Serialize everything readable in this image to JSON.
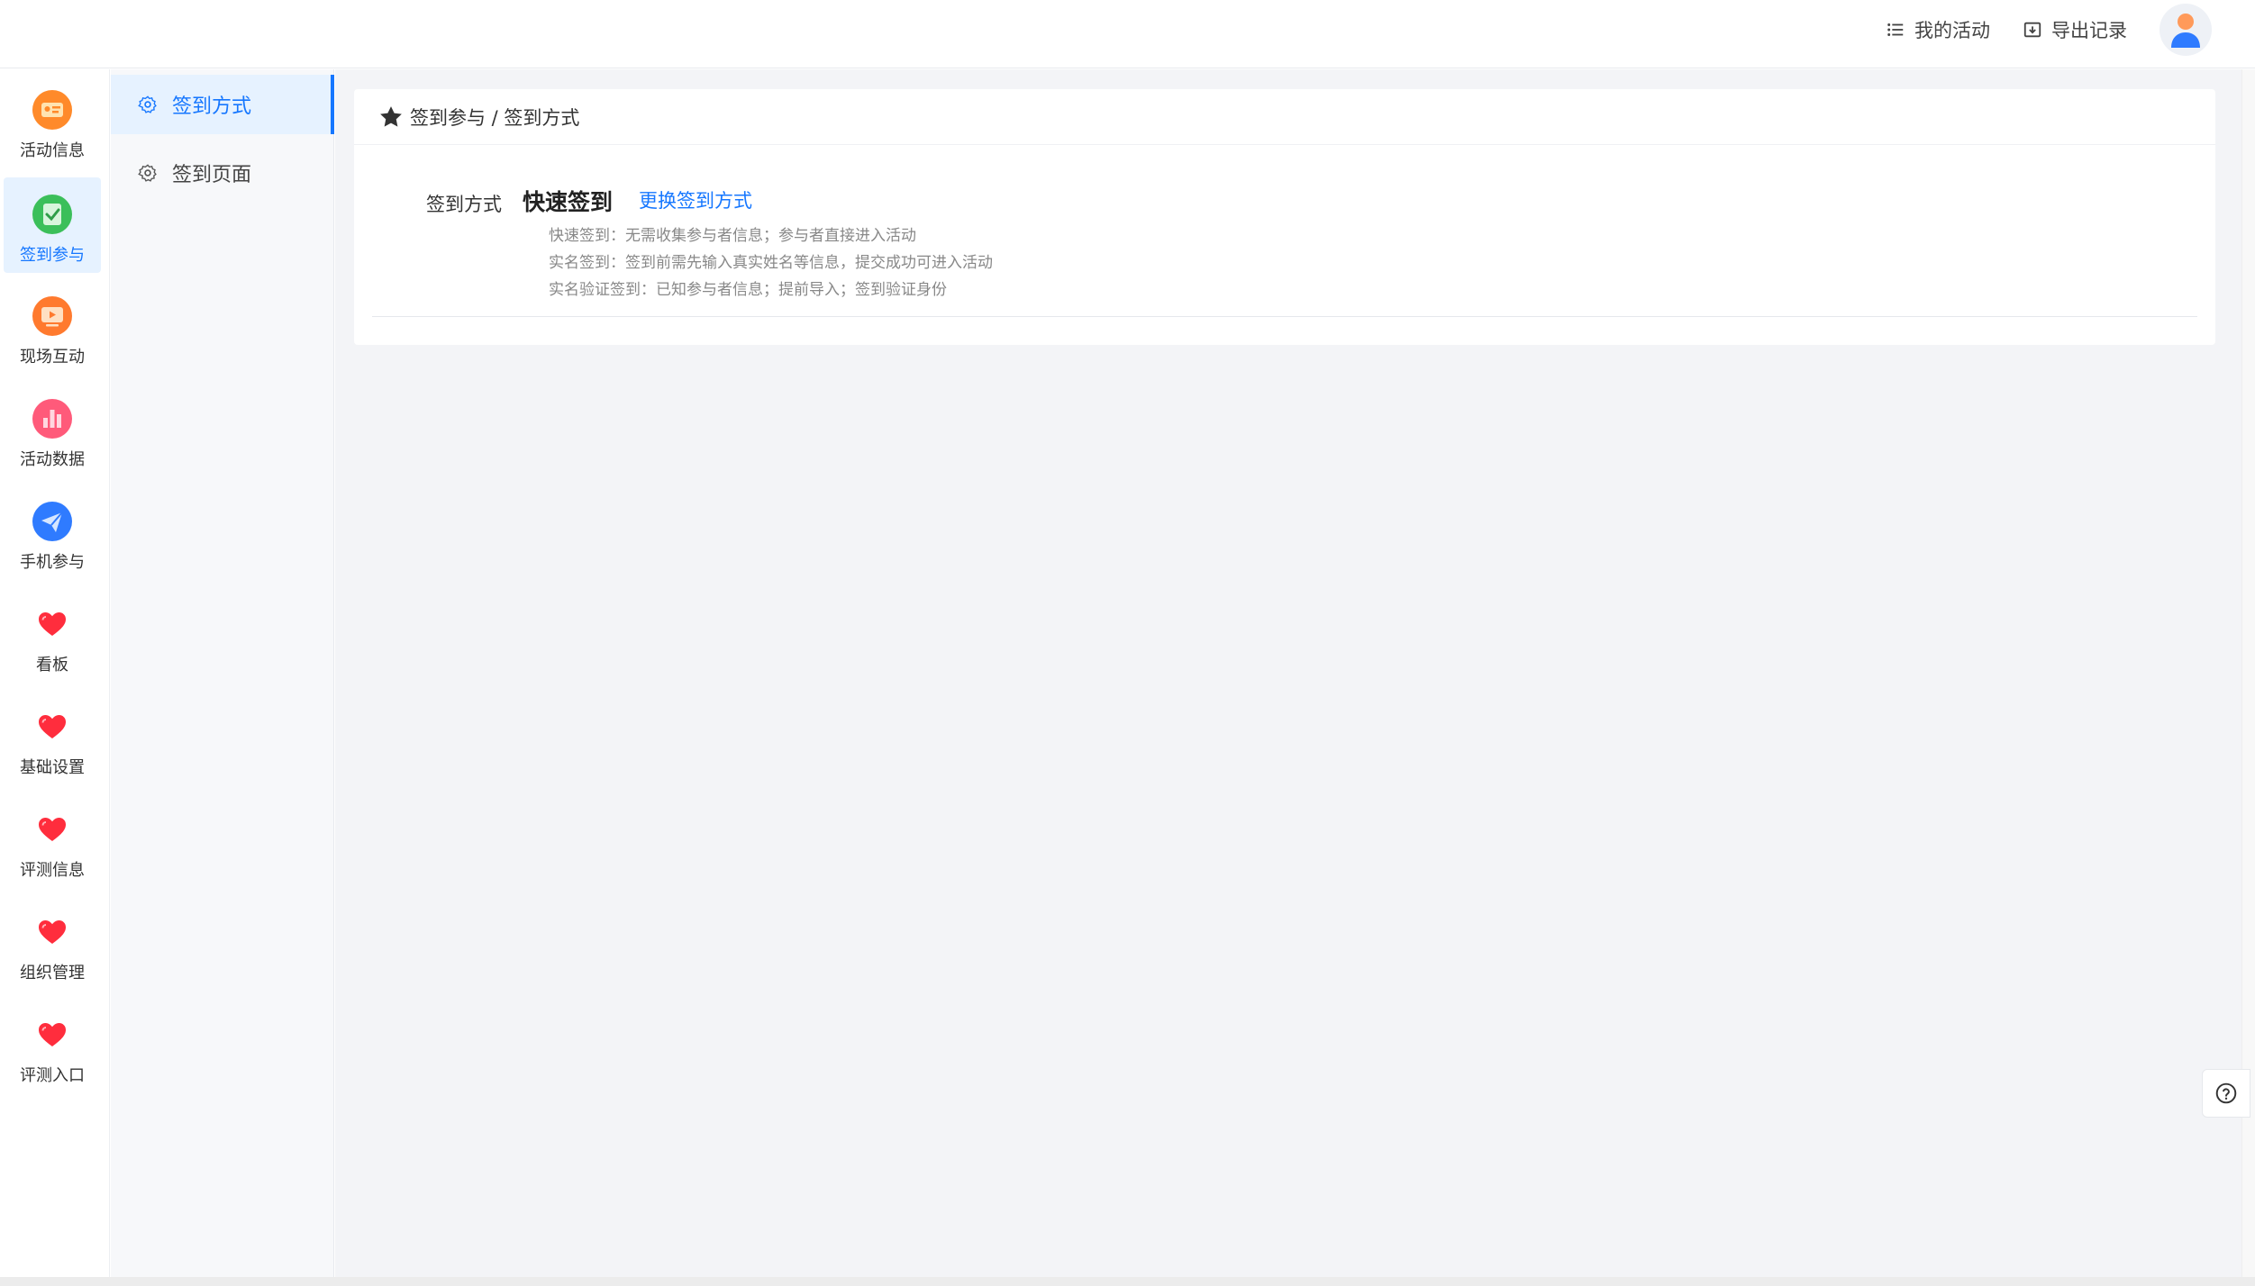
{
  "header": {
    "my_activity": "我的活动",
    "export_records": "导出记录"
  },
  "leftnav": {
    "items": [
      {
        "label": "活动信息",
        "icon": "id-card-icon",
        "color": "#ff8a2a"
      },
      {
        "label": "签到参与",
        "icon": "check-clipboard-icon",
        "color": "#3bbf5a",
        "active": true
      },
      {
        "label": "现场互动",
        "icon": "screen-play-icon",
        "color": "#ff7a2e"
      },
      {
        "label": "活动数据",
        "icon": "bar-chart-icon",
        "color": "#ff5a7a"
      },
      {
        "label": "手机参与",
        "icon": "paper-plane-icon",
        "color": "#2f7bff"
      },
      {
        "label": "看板",
        "icon": "heart-icon",
        "color": "#ff2d3d"
      },
      {
        "label": "基础设置",
        "icon": "heart-icon",
        "color": "#ff2d3d"
      },
      {
        "label": "评测信息",
        "icon": "heart-icon",
        "color": "#ff2d3d"
      },
      {
        "label": "组织管理",
        "icon": "heart-icon",
        "color": "#ff2d3d"
      },
      {
        "label": "评测入口",
        "icon": "heart-icon",
        "color": "#ff2d3d"
      }
    ]
  },
  "submenu": {
    "items": [
      {
        "label": "签到方式",
        "active": true
      },
      {
        "label": "签到页面"
      }
    ]
  },
  "content": {
    "breadcrumb": "签到参与 / 签到方式",
    "row_label": "签到方式",
    "method_name": "快速签到",
    "change_link": "更换签到方式",
    "descriptions": [
      "快速签到：无需收集参与者信息；参与者直接进入活动",
      "实名签到：签到前需先输入真实姓名等信息，提交成功可进入活动",
      "实名验证签到：已知参与者信息；提前导入；签到验证身份"
    ]
  },
  "colors": {
    "accent": "#1677ff",
    "active_bg": "#e6f2ff"
  }
}
